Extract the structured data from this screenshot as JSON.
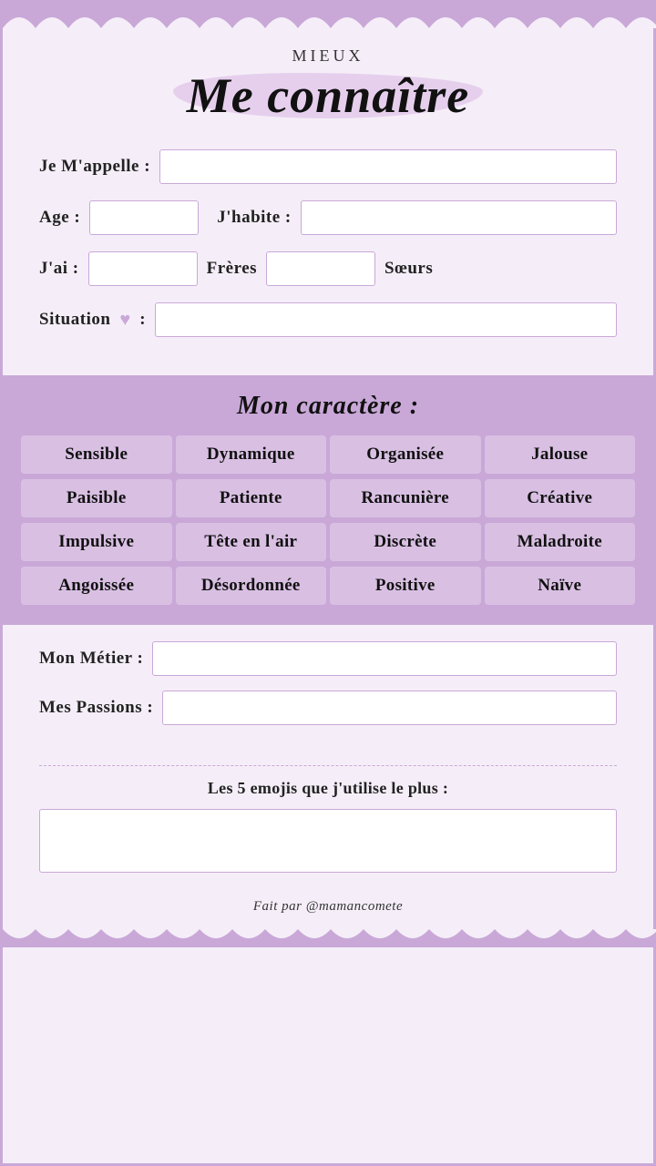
{
  "colors": {
    "purple": "#c9a8d8",
    "bg": "#f5eef8",
    "text": "#111"
  },
  "header": {
    "subtitle": "mieux",
    "title": "Me connaître"
  },
  "form": {
    "name_label": "Je m'appelle :",
    "name_placeholder": "",
    "age_label": "Age :",
    "age_placeholder": "",
    "habite_label": "J'habite :",
    "habite_placeholder": "",
    "jai_label": "J'ai :",
    "freres_label": "Frères",
    "soeurs_label": "Sœurs",
    "situation_label": "Situation",
    "situation_placeholder": ""
  },
  "personality": {
    "section_title": "Mon caractère :",
    "items": [
      "Sensible",
      "Dynamique",
      "Organisée",
      "Jalouse",
      "Paisible",
      "Patiente",
      "Rancunière",
      "Créative",
      "Impulsive",
      "Tête en l'air",
      "Discrète",
      "Maladroite",
      "Angoissée",
      "Désordonnée",
      "Positive",
      "Naïve"
    ]
  },
  "lower": {
    "metier_label": "Mon métier :",
    "metier_placeholder": "",
    "passions_label": "Mes passions :",
    "passions_placeholder": ""
  },
  "emoji": {
    "label": "Les 5 emojis que j'utilise le plus :",
    "placeholder": ""
  },
  "footer": {
    "text": "Fait par @mamancomete"
  }
}
